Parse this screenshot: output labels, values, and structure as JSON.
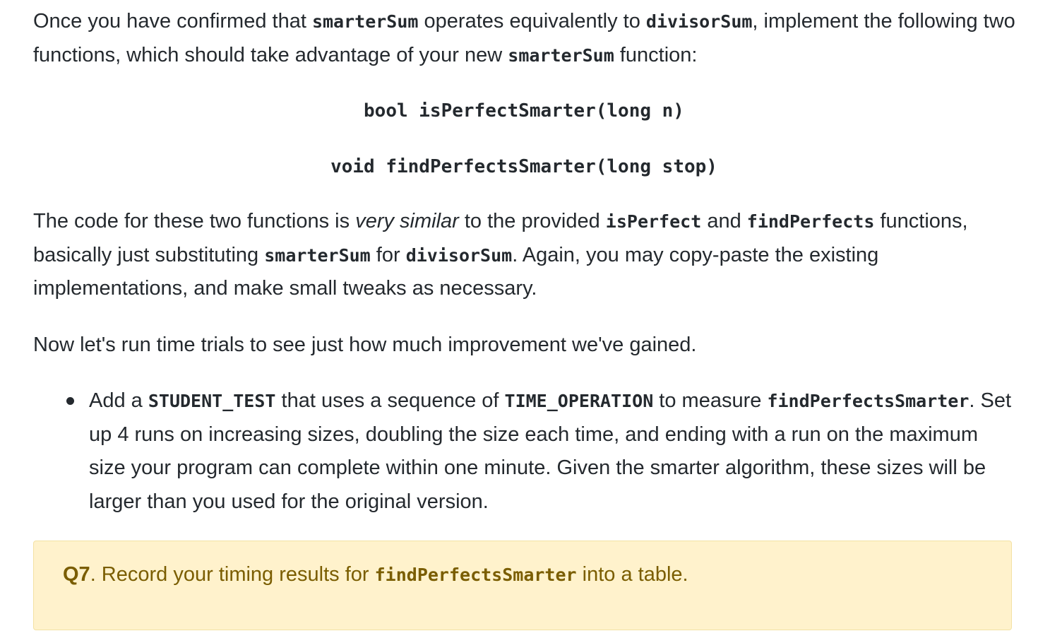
{
  "paragraph1": {
    "t1": "Once you have confirmed that ",
    "c1": "smarterSum",
    "t2": " operates equivalently to ",
    "c2": "divisorSum",
    "t3": ", implement the following two functions, which should take advantage of your new ",
    "c3": "smarterSum",
    "t4": " function:"
  },
  "signatures": [
    "bool isPerfectSmarter(long n)",
    "void findPerfectsSmarter(long stop)"
  ],
  "paragraph2": {
    "t1": "The code for these two functions is ",
    "em1": "very similar",
    "t2": " to the provided ",
    "c1": "isPerfect",
    "t3": " and ",
    "c2": "findPerfects",
    "t4": " functions, basically just substituting ",
    "c3": "smarterSum",
    "t5": " for ",
    "c4": "divisorSum",
    "t6": ". Again, you may copy-paste the existing implementations, and make small tweaks as necessary."
  },
  "paragraph3": "Now let's run time trials to see just how much improvement we've gained.",
  "bullet": {
    "t1": "Add a ",
    "c1": "STUDENT_TEST",
    "t2": " that uses a sequence of ",
    "c2": "TIME_OPERATION",
    "t3": " to measure ",
    "c3": "findPerfectsSmarter",
    "t4": ". Set up 4 runs on increasing sizes, doubling the size each time, and ending with a run on the maximum size your program can complete within one minute. Given the smarter algorithm, these sizes will be larger than you used for the original version."
  },
  "callout": {
    "label": "Q7",
    "t1": ". Record your timing results for ",
    "c1": "findPerfectsSmarter",
    "t2": " into a table.",
    "background": "#fff2cc",
    "text_color": "#7a5d00"
  }
}
